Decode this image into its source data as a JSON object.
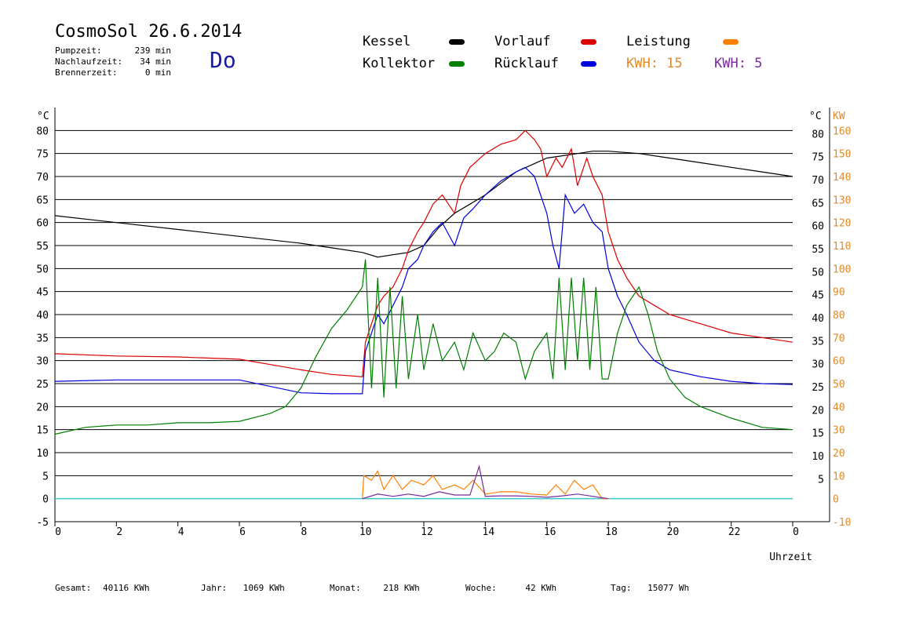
{
  "header": {
    "title": "CosmoSol 26.6.2014",
    "day": "Do",
    "stats": [
      {
        "label": "Pumpzeit:",
        "value": "239 min"
      },
      {
        "label": "Nachlaufzeit:",
        "value": "34 min"
      },
      {
        "label": "Brennerzeit:",
        "value": "0 min"
      }
    ]
  },
  "legend": [
    {
      "label": "Kessel",
      "color": "#000000"
    },
    {
      "label": "Vorlauf",
      "color": "#dd0000"
    },
    {
      "label": "Leistung",
      "color": "#ff8000"
    },
    {
      "label": "Kollektor",
      "color": "#008000"
    },
    {
      "label": "Rücklauf",
      "color": "#0000dd"
    }
  ],
  "kwh": [
    {
      "label": "KWH: 15",
      "color": "#e08a2a"
    },
    {
      "label": "KWH: 5",
      "color": "#7b2a9c"
    }
  ],
  "footer": [
    {
      "label": "Gesamt:",
      "value": "40116 KWh"
    },
    {
      "label": "Jahr:",
      "value": "1069 KWh"
    },
    {
      "label": "Monat:",
      "value": "218 KWh"
    },
    {
      "label": "Woche:",
      "value": "42 KWh"
    },
    {
      "label": "Tag:",
      "value": "15077 Wh"
    }
  ],
  "chart_data": {
    "type": "line",
    "xlabel": "Uhrzeit",
    "ylabel_left": "°C",
    "ylabel_right_1": "°C",
    "ylabel_right_2": "KW",
    "xlim": [
      0,
      24
    ],
    "ylim": [
      -5,
      85
    ],
    "ylim_kw": [
      -10,
      170
    ],
    "x_ticks": [
      "0",
      "2",
      "4",
      "6",
      "8",
      "10",
      "12",
      "14",
      "16",
      "18",
      "20",
      "22",
      "0"
    ],
    "y_ticks": [
      80,
      75,
      70,
      65,
      60,
      55,
      50,
      45,
      40,
      35,
      30,
      25,
      20,
      15,
      10,
      5,
      0,
      -5
    ],
    "y_ticks_right": [
      80,
      75,
      70,
      65,
      60,
      55,
      50,
      45,
      40,
      35,
      30,
      25,
      20,
      15,
      10,
      5
    ],
    "kw_ticks": [
      160,
      150,
      140,
      130,
      120,
      110,
      100,
      90,
      80,
      70,
      60,
      50,
      40,
      30,
      20,
      10,
      0,
      -10
    ],
    "grid": true,
    "series": [
      {
        "name": "Kessel",
        "color": "#000000",
        "x": [
          0,
          2,
          4,
          6,
          8,
          9,
          10,
          10.5,
          11,
          11.5,
          12,
          12.5,
          13,
          13.5,
          14,
          14.5,
          15,
          15.5,
          16,
          16.5,
          17,
          17.5,
          18,
          19,
          20,
          21,
          22,
          23,
          24
        ],
        "y": [
          61.5,
          60,
          58.5,
          57,
          55.5,
          54.5,
          53.5,
          52.5,
          53,
          53.5,
          55,
          59,
          62,
          64,
          66,
          68.5,
          71,
          72.5,
          74,
          74.5,
          75,
          75.5,
          75.5,
          75,
          74,
          73,
          72,
          71,
          70
        ]
      },
      {
        "name": "Vorlauf",
        "color": "#dd0000",
        "x": [
          0,
          2,
          4,
          6,
          8,
          9,
          10,
          10.1,
          10.3,
          10.5,
          10.7,
          11,
          11.3,
          11.5,
          11.8,
          12,
          12.3,
          12.6,
          13,
          13.2,
          13.5,
          14,
          14.5,
          15,
          15.3,
          15.6,
          15.8,
          16,
          16.3,
          16.5,
          16.8,
          17,
          17.3,
          17.5,
          17.8,
          18,
          18.3,
          18.6,
          19,
          19.5,
          20,
          21,
          22,
          23,
          24
        ],
        "y": [
          31.5,
          31,
          30.8,
          30.3,
          28,
          27,
          26.5,
          34,
          38,
          42,
          44,
          46,
          50,
          54,
          58,
          60,
          64,
          66,
          62,
          68,
          72,
          75,
          77,
          78,
          80,
          78,
          76,
          70,
          74,
          72,
          76,
          68,
          74,
          70,
          66,
          58,
          52,
          48,
          44,
          42,
          40,
          38,
          36,
          35,
          34
        ]
      },
      {
        "name": "Rücklauf",
        "color": "#0000dd",
        "x": [
          0,
          2,
          4,
          6,
          8,
          9,
          10,
          10.1,
          10.3,
          10.5,
          10.7,
          11,
          11.3,
          11.5,
          11.8,
          12,
          12.3,
          12.6,
          13,
          13.3,
          13.6,
          14,
          14.5,
          15,
          15.3,
          15.6,
          15.8,
          16,
          16.2,
          16.4,
          16.6,
          16.9,
          17.2,
          17.5,
          17.8,
          18,
          18.3,
          18.6,
          19,
          19.5,
          20,
          21,
          22,
          23,
          24
        ],
        "y": [
          25.5,
          25.8,
          25.8,
          25.8,
          23,
          22.8,
          22.8,
          32,
          36,
          40,
          38,
          42,
          46,
          50,
          52,
          55,
          58,
          60,
          55,
          61,
          63,
          66,
          69,
          71,
          72,
          70,
          66,
          62,
          55,
          50,
          66,
          62,
          64,
          60,
          58,
          50,
          44,
          40,
          34,
          30,
          28,
          26.5,
          25.5,
          25,
          24.8
        ]
      },
      {
        "name": "Kollektor",
        "color": "#008000",
        "x": [
          0,
          1,
          2,
          3,
          4,
          5,
          6,
          7,
          7.5,
          8,
          8.5,
          9,
          9.5,
          10,
          10.1,
          10.3,
          10.5,
          10.7,
          10.9,
          11.1,
          11.3,
          11.5,
          11.8,
          12,
          12.3,
          12.6,
          13,
          13.3,
          13.6,
          14,
          14.3,
          14.6,
          15,
          15.3,
          15.6,
          16,
          16.2,
          16.4,
          16.6,
          16.8,
          17,
          17.2,
          17.4,
          17.6,
          17.8,
          18,
          18.3,
          18.6,
          19,
          19.3,
          19.6,
          20,
          20.5,
          21,
          22,
          23,
          24
        ],
        "y": [
          14,
          15.5,
          16,
          16,
          16.5,
          16.5,
          16.8,
          18.5,
          20,
          24,
          31,
          37,
          41,
          46,
          52,
          24,
          48,
          22,
          46,
          24,
          44,
          26,
          40,
          28,
          38,
          30,
          34,
          28,
          36,
          30,
          32,
          36,
          34,
          26,
          32,
          36,
          26,
          48,
          28,
          48,
          30,
          48,
          28,
          46,
          26,
          26,
          36,
          42,
          46,
          40,
          32,
          26,
          22,
          20,
          17.5,
          15.5,
          15
        ]
      },
      {
        "name": "Leistung",
        "color": "#ff8000",
        "x": [
          10,
          10.05,
          10.3,
          10.5,
          10.7,
          11,
          11.3,
          11.6,
          12,
          12.3,
          12.6,
          13,
          13.3,
          13.6,
          14,
          14.5,
          15,
          15.5,
          16,
          16.3,
          16.6,
          16.9,
          17.2,
          17.5,
          17.8,
          18
        ],
        "y": [
          0,
          5,
          4,
          6,
          2,
          5,
          2,
          4,
          3,
          5,
          2,
          3,
          2,
          4,
          1,
          1.5,
          1.5,
          1,
          0.8,
          3,
          1,
          4,
          2,
          3,
          0,
          0
        ]
      },
      {
        "name": "Leistung 2",
        "color": "#7b2a9c",
        "x": [
          10,
          10.5,
          11,
          11.5,
          12,
          12.5,
          13,
          13.5,
          13.8,
          14,
          14.5,
          15,
          15.5,
          16,
          16.5,
          17,
          17.5,
          18
        ],
        "y": [
          0,
          1,
          0.5,
          1,
          0.5,
          1.5,
          0.8,
          0.8,
          7,
          0.5,
          0.6,
          0.6,
          0.5,
          0.3,
          0.6,
          1,
          0.5,
          0
        ]
      }
    ],
    "baseline": {
      "color": "#3cc8c8",
      "y": 0
    }
  }
}
